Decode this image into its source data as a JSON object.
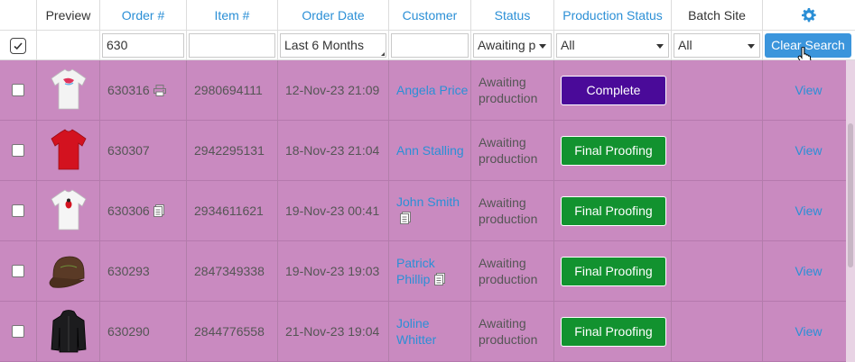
{
  "header": {
    "columns": [
      "Preview",
      "Order #",
      "Item #",
      "Order Date",
      "Customer",
      "Status",
      "Production Status",
      "Batch Site"
    ],
    "gear_icon": "gear-icon"
  },
  "filters": {
    "select_all_checked": true,
    "order": "630",
    "item": "",
    "order_date": "Last 6 Months",
    "customer": "",
    "status": "Awaiting p",
    "production_status": "All",
    "batch_site": "All",
    "clear_label": "Clear Search"
  },
  "rows": [
    {
      "order": "630316",
      "item": "2980694111",
      "date": "12-Nov-23 21:09",
      "customer": "Angela Price",
      "status": "Awaiting production",
      "production": "Complete",
      "production_color": "#4a0a99",
      "view": "View",
      "order_icon": "printer-icon"
    },
    {
      "order": "630307",
      "item": "2942295131",
      "date": "18-Nov-23 21:04",
      "customer": "Ann Stalling",
      "status": "Awaiting production",
      "production": "Final Proofing",
      "production_color": "#12922f",
      "view": "View"
    },
    {
      "order": "630306",
      "item": "2934611621",
      "date": "19-Nov-23 00:41",
      "customer": "John Smith",
      "status": "Awaiting production",
      "production": "Final Proofing",
      "production_color": "#12922f",
      "view": "View",
      "order_icon": "notes-icon",
      "customer_icon": "notes-icon"
    },
    {
      "order": "630293",
      "item": "2847349338",
      "date": "19-Nov-23 19:03",
      "customer": "Patrick Phillip",
      "status": "Awaiting production",
      "production": "Final Proofing",
      "production_color": "#12922f",
      "view": "View",
      "customer_icon": "notes-icon"
    },
    {
      "order": "630290",
      "item": "2844776558",
      "date": "21-Nov-23 19:04",
      "customer": "Joline Whitter",
      "status": "Awaiting production",
      "production": "Final Proofing",
      "production_color": "#12922f",
      "view": "View"
    }
  ],
  "colors": {
    "row_bg": "#c98ac0",
    "link": "#2b8fd6",
    "accent": "#3b95dc"
  }
}
